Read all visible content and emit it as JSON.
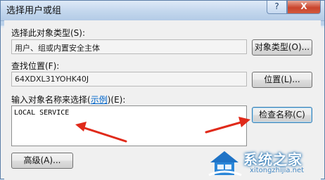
{
  "window": {
    "title": "选择用户或组",
    "help_label": "?",
    "close_label": "X"
  },
  "object_type": {
    "label": "选择此对象类型(S):",
    "value": "用户、组或内置安全主体",
    "button": "对象类型(O)..."
  },
  "location": {
    "label": "查找位置(F):",
    "value": "64XDXL31YOHK40J",
    "button": "位置(L)..."
  },
  "names": {
    "label_prefix": "输入对象名称来选择(",
    "label_link": "示例",
    "label_suffix": ")(E):",
    "value": "LOCAL SERVICE",
    "check_button": "检查名称(C)"
  },
  "advanced_button": "高级(A)...",
  "watermark": {
    "text": "系统之家",
    "url": "xitongzhijia.net"
  },
  "colors": {
    "arrow": "#e02a1a",
    "link": "#0066cc"
  }
}
